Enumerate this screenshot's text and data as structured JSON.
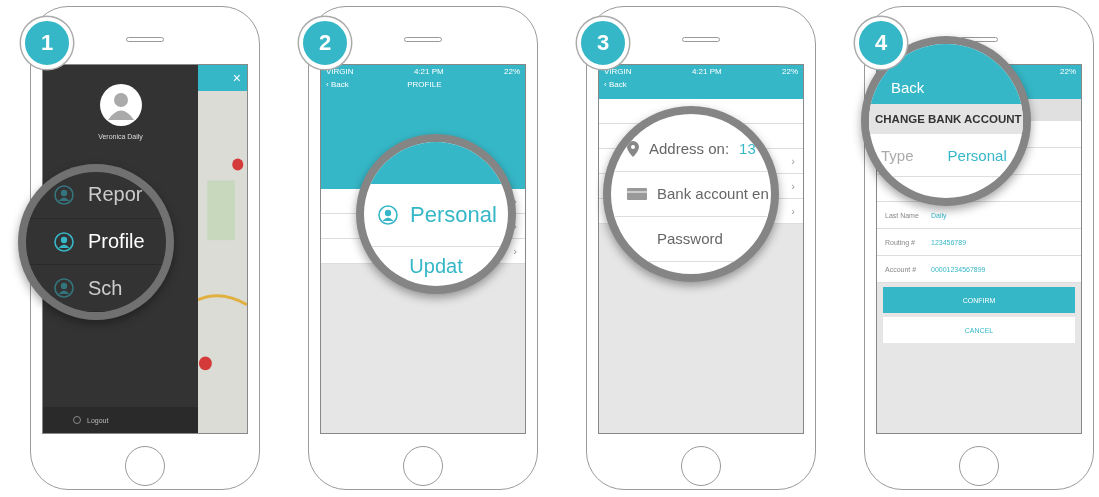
{
  "steps": [
    {
      "number": "1",
      "kind": "menu",
      "user_name": "Veronica Daily",
      "close": "×",
      "logout": "Logout",
      "magnifier": {
        "rows": [
          {
            "label": "Repor",
            "selected": false
          },
          {
            "label": "Profile",
            "selected": true
          },
          {
            "label": "Sch",
            "selected": false
          }
        ]
      }
    },
    {
      "number": "2",
      "kind": "profile",
      "status": {
        "carrier": "VIRGIN",
        "time": "4:21 PM",
        "battery": "22%"
      },
      "back_icon": "‹",
      "back": "Back",
      "title": "PROFILE",
      "rows": [
        {
          "chevron": "›"
        },
        {
          "chevron": "›"
        },
        {
          "chevron": "›"
        }
      ],
      "magnifier": {
        "label": "Personal",
        "next": "Updat"
      }
    },
    {
      "number": "3",
      "kind": "personal",
      "status": {
        "carrier": "VIRGIN",
        "time": "4:21 PM",
        "battery": "22%"
      },
      "back_icon": "‹",
      "back": "Back",
      "rows": [
        {
          "chevron": ""
        },
        {
          "chevron": ""
        },
        {
          "chevron": "›"
        },
        {
          "chevron": "›"
        },
        {
          "chevron": "›"
        }
      ],
      "magnifier": {
        "rows": [
          {
            "kind": "pin",
            "label": "Address on:",
            "value": "13"
          },
          {
            "kind": "card",
            "label": "Bank account en"
          },
          {
            "kind": "plain",
            "label": "Password"
          }
        ]
      }
    },
    {
      "number": "4",
      "kind": "bank",
      "status": {
        "battery": "22%"
      },
      "fields": [
        {
          "label": "Last Name",
          "value": "Daily"
        },
        {
          "label": "Routing #",
          "value": "123456789"
        },
        {
          "label": "Account #",
          "value": "00001234567899"
        }
      ],
      "confirm": "CONFIRM",
      "cancel": "CANCEL",
      "magnifier": {
        "back": "Back",
        "heading": "CHANGE BANK ACCOUNT",
        "type_label": "Type",
        "type_value": "Personal"
      }
    }
  ]
}
